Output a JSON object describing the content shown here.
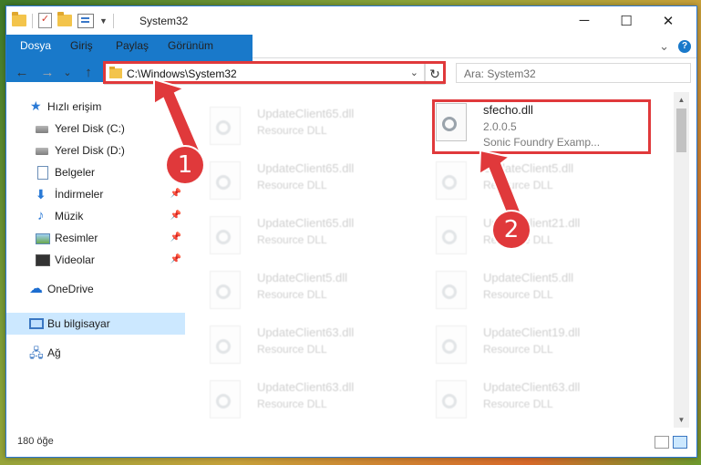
{
  "window": {
    "title": "System32",
    "minimize_glyph": "─",
    "maximize_glyph": "☐",
    "close_glyph": "✕"
  },
  "ribbon": {
    "tabs": [
      "Dosya",
      "Giriş",
      "Paylaş",
      "Görünüm"
    ],
    "expand_glyph": "⌄",
    "help_glyph": "?"
  },
  "nav": {
    "back": "←",
    "forward": "→",
    "history": "⌄",
    "up": "↑",
    "address": "C:\\Windows\\System32",
    "address_dropdown": "⌄",
    "refresh": "↻",
    "search_placeholder": "Ara: System32"
  },
  "sidebar": {
    "items": [
      {
        "label": "Hızlı erişim",
        "icon": "star-icon",
        "pinned": false
      },
      {
        "label": "Yerel Disk (C:)",
        "icon": "drive-icon",
        "pinned": false
      },
      {
        "label": "Yerel Disk (D:)",
        "icon": "drive-icon",
        "pinned": false
      },
      {
        "label": "Belgeler",
        "icon": "document-icon",
        "pinned": false
      },
      {
        "label": "İndirmeler",
        "icon": "download-icon",
        "pinned": true
      },
      {
        "label": "Müzik",
        "icon": "music-icon",
        "pinned": true
      },
      {
        "label": "Resimler",
        "icon": "pictures-icon",
        "pinned": true
      },
      {
        "label": "Videolar",
        "icon": "video-icon",
        "pinned": true
      },
      {
        "label": "OneDrive",
        "icon": "cloud-icon",
        "pinned": false
      },
      {
        "label": "Bu bilgisayar",
        "icon": "computer-icon",
        "pinned": false,
        "selected": true
      },
      {
        "label": "Ağ",
        "icon": "network-icon",
        "pinned": false
      }
    ],
    "pin_glyph": "📌"
  },
  "files": {
    "left": [
      {
        "name": "UpdateClient65.dll",
        "type": "Resource DLL"
      },
      {
        "name": "UpdateClient65.dll",
        "type": "Resource DLL"
      },
      {
        "name": "UpdateClient65.dll",
        "type": "Resource DLL"
      },
      {
        "name": "UpdateClient5.dll",
        "type": "Resource DLL"
      },
      {
        "name": "UpdateClient63.dll",
        "type": "Resource DLL"
      },
      {
        "name": "UpdateClient63.dll",
        "type": "Resource DLL"
      }
    ],
    "highlight": {
      "name": "sfecho.dll",
      "version": "2.0.0.5",
      "description": "Sonic Foundry Examp..."
    },
    "right": [
      {
        "name": "UpdateClient5.dll",
        "type": "Resource DLL"
      },
      {
        "name": "UpdateClient21.dll",
        "type": "Resource DLL"
      },
      {
        "name": "UpdateClient5.dll",
        "type": "Resource DLL"
      },
      {
        "name": "UpdateClient19.dll",
        "type": "Resource DLL"
      },
      {
        "name": "UpdateClient63.dll",
        "type": "Resource DLL"
      }
    ]
  },
  "status": {
    "item_count": "180 öğe"
  },
  "annotations": {
    "step1": "1",
    "step2": "2",
    "color": "#e0393b"
  }
}
